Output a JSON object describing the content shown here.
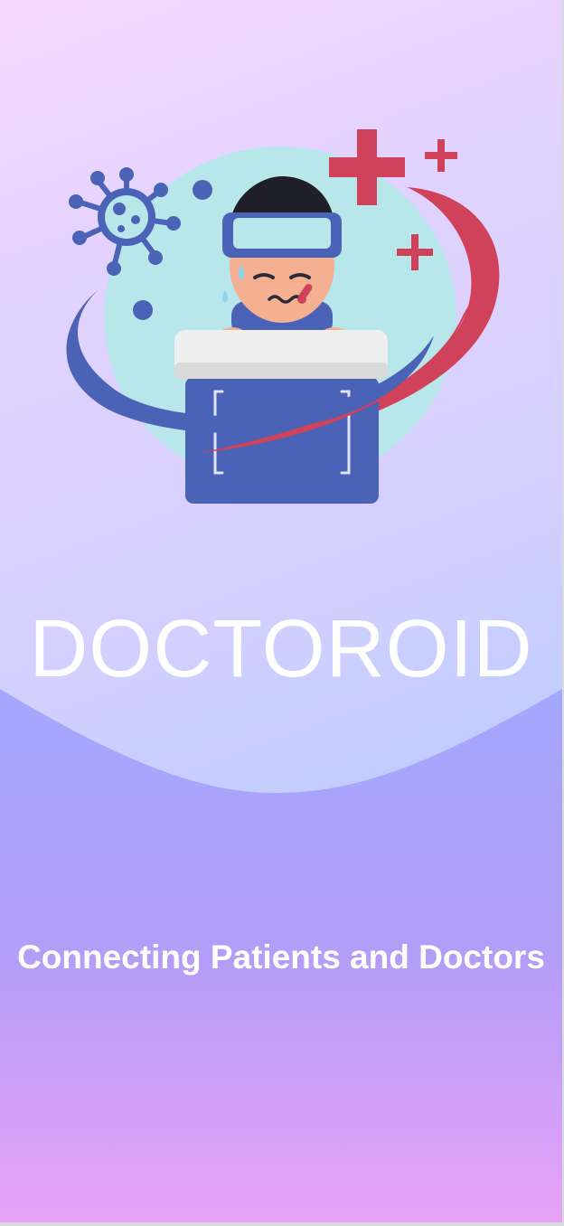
{
  "splash": {
    "app_name": "DOCTOROID",
    "tagline": "Connecting Patients and Doctors"
  },
  "illustration": {
    "subject": "sick-patient-in-bed",
    "icons": [
      "virus-icon",
      "medical-cross-icon",
      "thermometer-icon"
    ]
  },
  "colors": {
    "background_top": "#f6d9ff",
    "background_mid": "#c1cdff",
    "wave_top": "#a4a7fe",
    "wave_bottom": "#e8a2f7",
    "brand_blue": "#4a63b7",
    "brand_red": "#d0415a",
    "accent_teal": "#b7e7ea",
    "text": "#ffffff"
  }
}
